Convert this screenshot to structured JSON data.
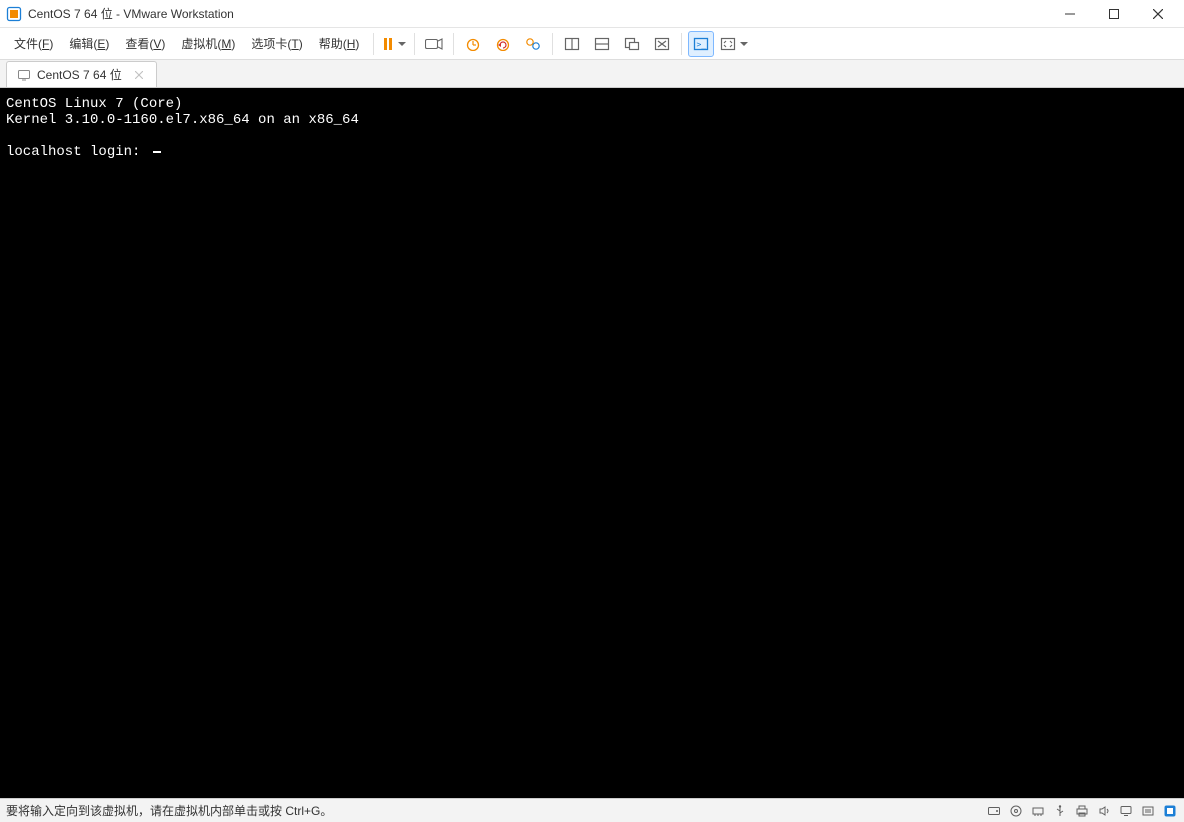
{
  "titlebar": {
    "title": "CentOS 7 64 位 - VMware Workstation"
  },
  "menubar": {
    "file": {
      "label": "文件(",
      "accel": "F",
      "suffix": ")"
    },
    "edit": {
      "label": "编辑(",
      "accel": "E",
      "suffix": ")"
    },
    "view": {
      "label": "查看(",
      "accel": "V",
      "suffix": ")"
    },
    "vm": {
      "label": "虚拟机(",
      "accel": "M",
      "suffix": ")"
    },
    "tabs": {
      "label": "选项卡(",
      "accel": "T",
      "suffix": ")"
    },
    "help": {
      "label": "帮助(",
      "accel": "H",
      "suffix": ")"
    }
  },
  "tabs": [
    {
      "label": "CentOS 7 64 位"
    }
  ],
  "console": {
    "line1": "CentOS Linux 7 (Core)",
    "line2": "Kernel 3.10.0-1160.el7.x86_64 on an x86_64",
    "line3": "",
    "prompt": "localhost login: "
  },
  "statusbar": {
    "hint": "要将输入定向到该虚拟机，请在虚拟机内部单击或按 Ctrl+G。"
  }
}
